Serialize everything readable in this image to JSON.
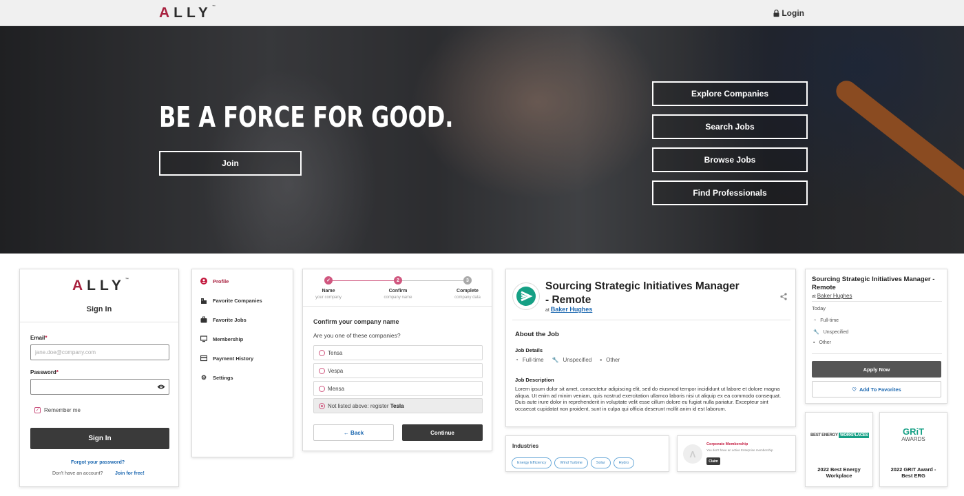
{
  "header": {
    "logo": "ALLY",
    "login_label": "Login"
  },
  "hero": {
    "title": "BE A FORCE FOR GOOD.",
    "join_label": "Join",
    "buttons": [
      "Explore Companies",
      "Search Jobs",
      "Browse Jobs",
      "Find Professionals"
    ]
  },
  "signin": {
    "logo": "ALLY",
    "title": "Sign In",
    "email_label": "Email",
    "email_placeholder": "jane.doe@company.com",
    "password_label": "Password",
    "remember_label": "Remember me",
    "submit_label": "Sign In",
    "forgot_label": "Forgot your password?",
    "no_account_text": "Don't have an account?",
    "join_free_label": "Join for free!"
  },
  "sidebar": {
    "items": [
      {
        "label": "Profile",
        "icon": "user-circle-icon"
      },
      {
        "label": "Favorite Companies",
        "icon": "building-icon"
      },
      {
        "label": "Favorite Jobs",
        "icon": "briefcase-icon"
      },
      {
        "label": "Membership",
        "icon": "monitor-icon"
      },
      {
        "label": "Payment History",
        "icon": "credit-card-icon"
      },
      {
        "label": "Settings",
        "icon": "gear-icon"
      }
    ]
  },
  "wizard": {
    "steps": [
      {
        "num": "✓",
        "label": "Name",
        "sub": "your company"
      },
      {
        "num": "2",
        "label": "Confirm",
        "sub": "company name"
      },
      {
        "num": "3",
        "label": "Complete",
        "sub": "company data"
      }
    ],
    "heading": "Confirm your company name",
    "question": "Are you one of these companies?",
    "options": [
      "Tensa",
      "Vespa",
      "Mensa"
    ],
    "not_listed_prefix": "Not listed above: register",
    "not_listed_name": "Tesla",
    "back_label": "← Back",
    "continue_label": "Continue"
  },
  "job": {
    "title_line1": "Sourcing Strategic Initiatives Manager",
    "title_line2": "- Remote",
    "at_label": "at",
    "company": "Baker Hughes",
    "about_heading": "About the Job",
    "details_heading": "Job Details",
    "details": [
      "Full-time",
      "Unspecified",
      "Other"
    ],
    "description_heading": "Job Description",
    "description": "Lorem ipsum dolor sit amet, consectetur adipiscing elit, sed do eiusmod tempor incididunt ut labore et dolore magna aliqua. Ut enim ad minim veniam, quis nostrud exercitation ullamco laboris nisi ut aliquip ex ea commodo consequat. Duis aute irure dolor in reprehenderit in voluptate velit esse cillum dolore eu fugiat nulla pariatur. Excepteur sint occaecat cupidatat non proident, sunt in culpa qui officia deserunt mollit anim id est laborum."
  },
  "industries": {
    "heading": "Industries",
    "chips": [
      "Energy Efficiency",
      "Wind Turbine",
      "Solar",
      "Hydro"
    ]
  },
  "membership": {
    "title": "Corporate Membership",
    "text": "You don't have an active Enterprise membership",
    "claim_label": "Claim"
  },
  "summary": {
    "title": "Sourcing Strategic Initiatives Manager - Remote",
    "at_label": "at",
    "company": "Baker Hughes",
    "posted": "Today",
    "meta": [
      "Full-time",
      "Unspecified",
      "Other"
    ],
    "apply_label": "Apply Now",
    "favorite_label": "Add To Favorites"
  },
  "awards": [
    {
      "logo_text_a": "BEST ENERGY",
      "logo_text_b": "WORKPLACES",
      "title": "2022 Best Energy Workplace"
    },
    {
      "logo_text_a": "GRiT",
      "logo_text_b": "AWARDS",
      "title": "2022 GRIT Award - Best ERG"
    }
  ],
  "colors": {
    "brand_red": "#a8213f",
    "accent_pink": "#d0577f",
    "link_blue": "#1b67b0",
    "dark_button": "#3a3a3a",
    "teal": "#16a085"
  }
}
